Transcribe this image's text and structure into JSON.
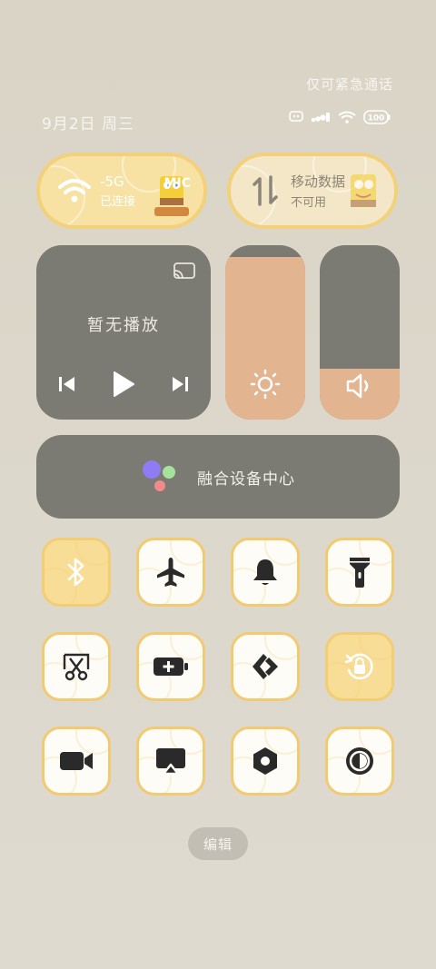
{
  "status_bar": {
    "emergency_text": "仅可紧急通话",
    "date_text": "9月2日 周三",
    "battery": "100"
  },
  "wifi_tile": {
    "line1": "-5G",
    "line2": "已连接",
    "badge": "MIC",
    "icon": "wifi-icon"
  },
  "data_tile": {
    "line1": "移动数据",
    "line2": "不可用",
    "icon": "mobile-data-arrows-icon"
  },
  "media": {
    "title": "暂无播放",
    "icons": [
      "cast-icon",
      "previous-icon",
      "play-icon",
      "next-icon"
    ]
  },
  "sliders": {
    "brightness_level": 0.93,
    "volume_level": 0.29
  },
  "fusion": {
    "label": "融合设备中心"
  },
  "toggles": [
    {
      "name": "bluetooth",
      "icon": "bluetooth-icon",
      "active": true
    },
    {
      "name": "airplane",
      "icon": "airplane-icon",
      "active": false
    },
    {
      "name": "bell",
      "icon": "bell-icon",
      "active": false
    },
    {
      "name": "flashlight",
      "icon": "flashlight-icon",
      "active": false
    },
    {
      "name": "screenshot",
      "icon": "scissors-icon",
      "active": false
    },
    {
      "name": "battery-saver",
      "icon": "battery-plus-icon",
      "active": false
    },
    {
      "name": "share",
      "icon": "share-arrows-icon",
      "active": false
    },
    {
      "name": "rotation-lock",
      "icon": "rotation-lock-icon",
      "active": true
    },
    {
      "name": "screen-record",
      "icon": "video-camera-icon",
      "active": false
    },
    {
      "name": "screen-cast",
      "icon": "screen-cast-icon",
      "active": false
    },
    {
      "name": "settings-hex",
      "icon": "hex-nut-icon",
      "active": false
    },
    {
      "name": "dark-mode",
      "icon": "dark-mode-icon",
      "active": false
    }
  ],
  "edit_label": "编辑",
  "colors": {
    "accent_yellow": "#f2ca72",
    "panel_gray": "#7b7a73",
    "slider_fill": "#e2b48f"
  }
}
